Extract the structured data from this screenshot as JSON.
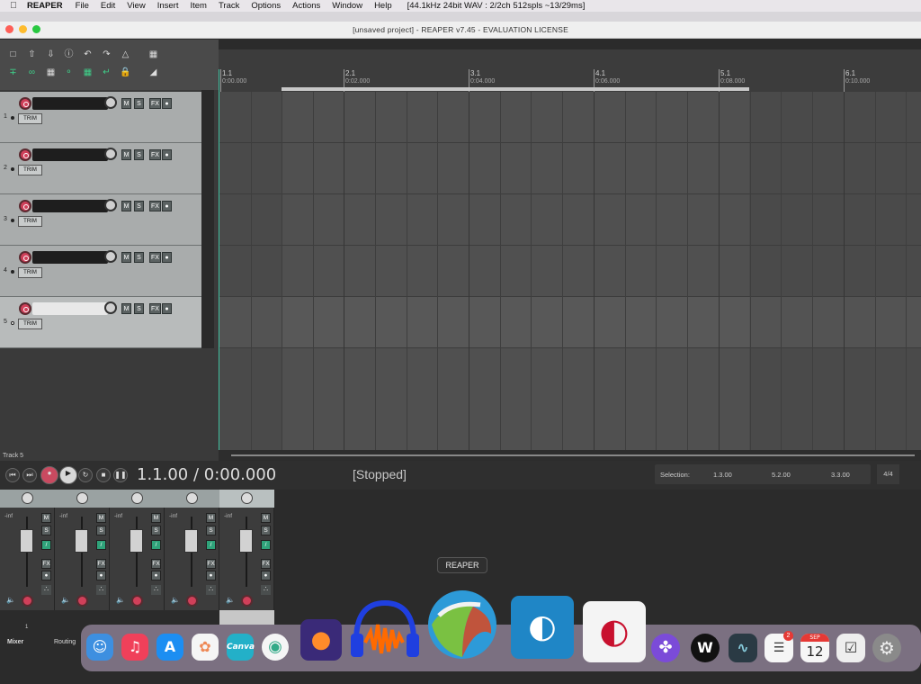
{
  "menubar": {
    "app": "REAPER",
    "items": [
      "File",
      "Edit",
      "View",
      "Insert",
      "Item",
      "Track",
      "Options",
      "Actions",
      "Window",
      "Help"
    ],
    "status": "[44.1kHz 24bit WAV : 2/2ch 512spls ~13/29ms]"
  },
  "window": {
    "title": "[unsaved project] - REAPER v7.45 - EVALUATION LICENSE"
  },
  "tracks": [
    {
      "num": "1",
      "trim": "TRIM"
    },
    {
      "num": "2",
      "trim": "TRIM"
    },
    {
      "num": "3",
      "trim": "TRIM"
    },
    {
      "num": "4",
      "trim": "TRIM"
    },
    {
      "num": "5",
      "trim": "TRIM"
    }
  ],
  "track_buttons": {
    "mute": "M",
    "solo": "S",
    "fx": "FX"
  },
  "ruler": [
    {
      "bar": "1.1",
      "time": "0:00.000"
    },
    {
      "bar": "2.1",
      "time": "0:02.000"
    },
    {
      "bar": "3.1",
      "time": "0:04.000"
    },
    {
      "bar": "4.1",
      "time": "0:06.000"
    },
    {
      "bar": "5.1",
      "time": "0:08.000"
    },
    {
      "bar": "6.1",
      "time": "0:10.000"
    }
  ],
  "transport": {
    "track_label": "Track 5",
    "time": "1.1.00 / 0:00.000",
    "state": "[Stopped]",
    "selection_label": "Selection:",
    "sel_start": "1.3.00",
    "sel_end": "5.2.00",
    "sel_len": "3.3.00",
    "time_sig": "4/4"
  },
  "mixer": {
    "strip_count": 5,
    "inf": "-inf",
    "mute": "M",
    "solo": "S",
    "fx": "FX",
    "tabs": [
      "Mixer",
      "Routing"
    ],
    "strip_number": "1"
  },
  "dock": {
    "tooltip": "REAPER",
    "canva": "Canva",
    "calendar_month": "SEP",
    "calendar_day": "12",
    "reminders_badge": "2"
  }
}
